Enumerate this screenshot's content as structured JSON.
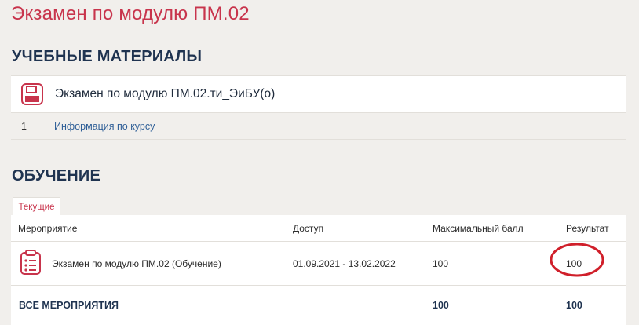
{
  "page": {
    "title": "Экзамен по модулю ПМ.02"
  },
  "materials": {
    "heading": "УЧЕБНЫЕ МАТЕРИАЛЫ",
    "item": {
      "title": "Экзамен по модулю ПМ.02.ти_ЭиБУ(о)",
      "icon": "save-floppy-icon"
    },
    "info": {
      "number": "1",
      "link": "Информация по курсу"
    }
  },
  "learning": {
    "heading": "ОБУЧЕНИЕ",
    "tab": "Текущие",
    "columns": [
      "Мероприятие",
      "Доступ",
      "Максимальный балл",
      "Результат"
    ],
    "rows": [
      {
        "event": "Экзамен по модулю ПМ.02 (Обучение)",
        "access": "01.09.2021 - 13.02.2022",
        "max": "100",
        "result": "100",
        "icon": "clipboard-list-icon"
      }
    ],
    "footer": {
      "label": "ВСЕ МЕРОПРИЯТИЯ",
      "max": "100",
      "result": "100"
    }
  },
  "colors": {
    "accent": "#c8344c",
    "heading": "#1f3350",
    "link": "#2f5f97",
    "annotation": "#d01f2a"
  }
}
